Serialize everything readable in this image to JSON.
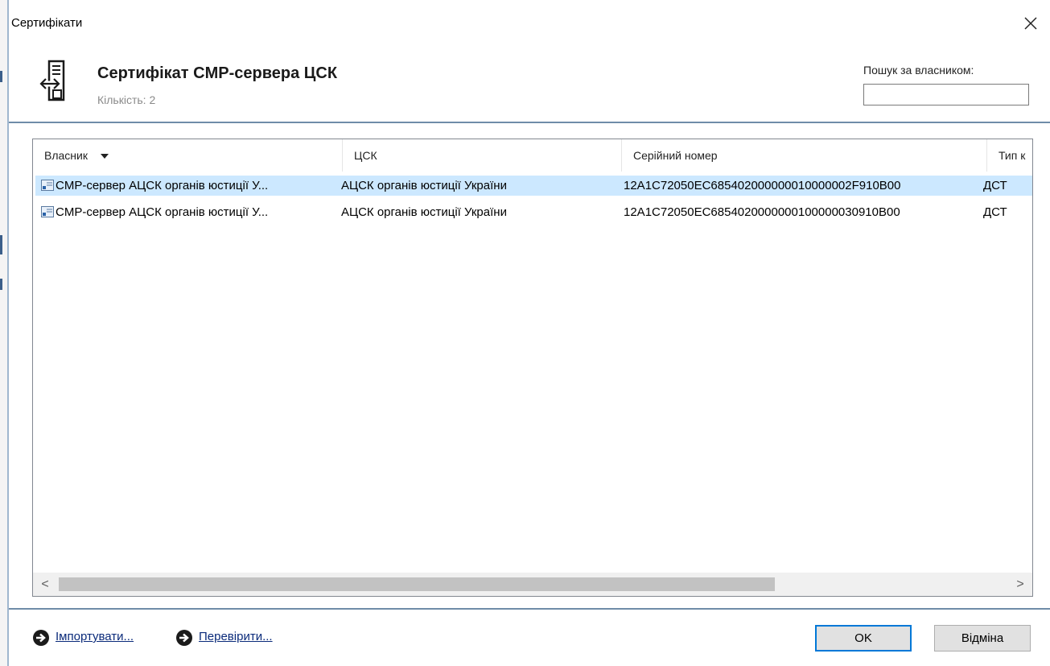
{
  "window": {
    "title": "Сертифікати",
    "close_icon": "close-icon"
  },
  "header": {
    "icon": "certificate-server-icon",
    "title": "Сертифікат CMP-сервера ЦСК",
    "count_label": "Кількість:",
    "count_value": "2",
    "search_label": "Пошук за власником:",
    "search_value": ""
  },
  "list": {
    "columns": [
      "Власник",
      "ЦСК",
      "Серійний номер",
      "Тип к"
    ],
    "sort_column": "Власник",
    "rows": [
      {
        "owner": "CMP-сервер АЦСК органів юстиції У...",
        "ca": "АЦСК органів юстиції України",
        "serial": "12A1C72050EC685402000000010000002F910B00",
        "type": "ДСТ",
        "selected": true
      },
      {
        "owner": "CMP-сервер АЦСК органів юстиції У...",
        "ca": "АЦСК органів юстиції України",
        "serial": "12A1C72050EC6854020000000100000030910B00",
        "type": "ДСТ",
        "selected": false
      }
    ],
    "scroll_left_glyph": "<",
    "scroll_right_glyph": ">"
  },
  "footer": {
    "import_label": "Імпортувати...",
    "check_label": "Перевірити...",
    "ok_label": "OK",
    "cancel_label": "Відміна"
  },
  "colors": {
    "selection": "#cce8ff",
    "separator": "#6f8ca8",
    "default_button_border": "#0078d7",
    "link": "#0a2a7a"
  }
}
